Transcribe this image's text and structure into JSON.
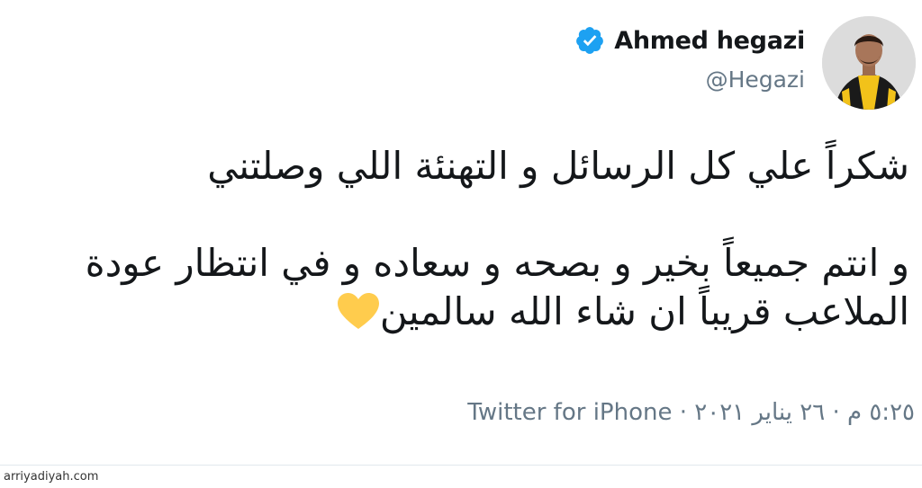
{
  "author": {
    "display_name": "Ahmed hegazi",
    "handle": "@Hegazi",
    "verified": true,
    "avatar": "player-avatar"
  },
  "tweet": {
    "lines": [
      "شكراً علي كل الرسائل و التهنئة اللي وصلتني",
      "و انتم جميعاً بخير و بصحه و سعاده و في انتظار عودة",
      "الملاعب قريباً ان شاء الله سالمين"
    ],
    "emoji": "yellow-heart"
  },
  "meta": {
    "timestamp": "٥:٢٥ م · ٢٦ يناير ٢٠٢١ ·",
    "source": "Twitter for iPhone"
  },
  "watermark": "arriyadiyah.com",
  "colors": {
    "verified": "#1da1f2",
    "heart": "#ffcc4d",
    "text": "#14171a",
    "secondary": "#657786"
  }
}
